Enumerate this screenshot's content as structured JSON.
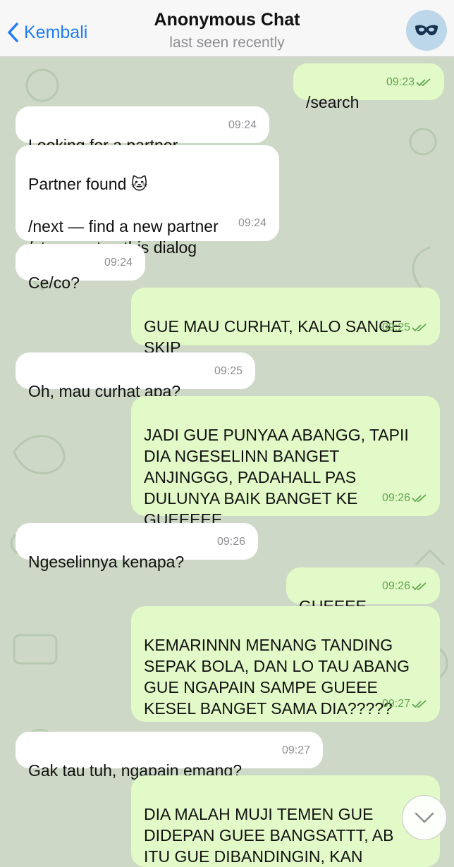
{
  "header": {
    "back_label": "Kembali",
    "title": "Anonymous Chat",
    "status": "last seen recently"
  },
  "messages": [
    {
      "dir": "out",
      "text": "/search",
      "time": "09:23"
    },
    {
      "dir": "in",
      "text": "Looking for a partner...",
      "time": "09:24"
    },
    {
      "dir": "in",
      "text": "Partner found 🐱\n\n/next — find a new partner\n/stop — stop this dialog",
      "time": "09:24"
    },
    {
      "dir": "in",
      "text": "Ce/co?",
      "time": "09:24"
    },
    {
      "dir": "out",
      "text": "GUE MAU CURHAT, KALO SANGE\nSKIP",
      "time": "09:25"
    },
    {
      "dir": "in",
      "text": "Oh, mau curhat apa?",
      "time": "09:25"
    },
    {
      "dir": "out",
      "text": "JADI GUE PUNYAA ABANGG, TAPII\nDIA NGESELINN BANGET\nANJINGGG, PADAHALL PAS\nDULUNYA BAIK BANGET KE\nGUEEEEE",
      "time": "09:26"
    },
    {
      "dir": "in",
      "text": "Ngeselinnya kenapa?",
      "time": "09:26"
    },
    {
      "dir": "out",
      "text": "GUEEEE",
      "time": "09:26"
    },
    {
      "dir": "out",
      "text": "KEMARINNN MENANG TANDING\nSEPAK BOLA, DAN LO TAU ABANG\nGUE NGAPAIN SAMPE GUEEE\nKESEL BANGET SAMA DIA?????",
      "time": "09:27"
    },
    {
      "dir": "in",
      "text": "Gak tau tuh, ngapain emang?",
      "time": "09:27"
    },
    {
      "dir": "out",
      "text": "DIA MALAH MUJI TEMEN GUE\nDIDEPAN GUEE BANGSATTT, AB\nITU GUE DIBANDINGIN, KAN",
      "time": ""
    }
  ],
  "colors": {
    "accent": "#1f7cf6",
    "incoming_bubble": "#ffffff",
    "outgoing_bubble": "#e2fac7",
    "outgoing_time": "#5fa54f",
    "wallpaper": "#cdd9c6"
  },
  "icons": {
    "back": "chevron-left-icon",
    "avatar": "mask-icon",
    "read": "double-check-icon",
    "scroll": "chevron-down-icon"
  }
}
